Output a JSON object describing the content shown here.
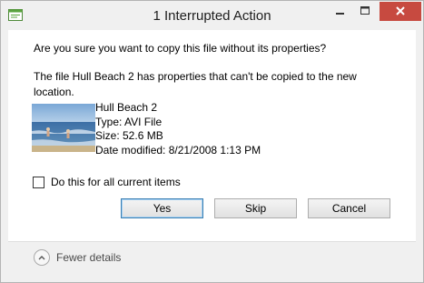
{
  "window": {
    "title": "1 Interrupted Action",
    "controls": {
      "minimize": "minimize-icon",
      "maximize": "maximize-icon",
      "close": "close-icon"
    }
  },
  "dialog": {
    "question": "Are you sure you want to copy this file without its properties?",
    "description": "The file Hull Beach 2 has properties that can't be copied to the new location.",
    "file": {
      "name": "Hull Beach 2",
      "type": "Type: AVI File",
      "size": "Size: 52.6 MB",
      "modified": "Date modified: 8/21/2008 1:13 PM"
    },
    "checkbox_label": "Do this for all current items",
    "checkbox_checked": false,
    "buttons": {
      "yes": "Yes",
      "skip": "Skip",
      "cancel": "Cancel"
    }
  },
  "footer": {
    "details_toggle": "Fewer details"
  },
  "colors": {
    "close_button": "#c74a40",
    "default_button_border": "#3c7fb1"
  }
}
